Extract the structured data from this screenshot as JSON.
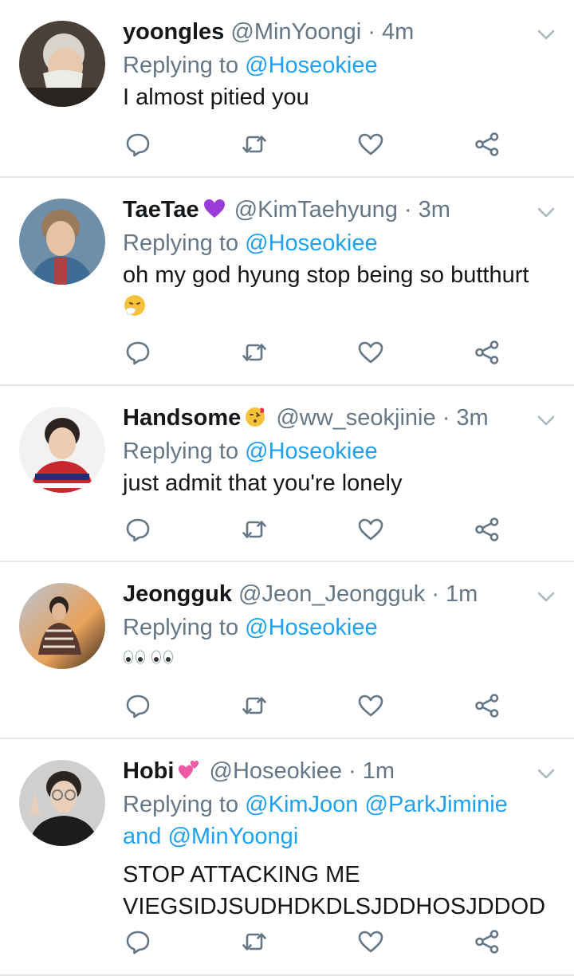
{
  "tweets": [
    {
      "name": "yoongles",
      "handle": "@MinYoongi",
      "time": "· 4m",
      "reply_prefix": "Replying to",
      "mentions": [
        "@Hoseokiee"
      ],
      "text": "I almost pitied you",
      "emoji": ""
    },
    {
      "name": "TaeTae",
      "handle": "@KimTaehyung",
      "time": "· 3m",
      "reply_prefix": "Replying to",
      "mentions": [
        "@Hoseokiee"
      ],
      "text": "oh my god hyung stop being so butthurt",
      "emoji": "purple-heart"
    },
    {
      "name": "Handsome",
      "handle": "@ww_seokjinie",
      "time": "· 3m",
      "reply_prefix": "Replying to",
      "mentions": [
        "@Hoseokiee"
      ],
      "text": "just admit that you're lonely",
      "emoji": "kiss-face"
    },
    {
      "name": "Jeongguk",
      "handle": "@Jeon_Jeongguk",
      "time": "· 1m",
      "reply_prefix": "Replying to",
      "mentions": [
        "@Hoseokiee"
      ],
      "text": "",
      "emoji": ""
    },
    {
      "name": "Hobi",
      "handle": "@Hoseokiee",
      "time": "· 1m",
      "reply_prefix": "Replying to",
      "mentions": [
        "@KimJoon",
        "@ParkJiminie",
        "@MinYoongi"
      ],
      "mention_joiner": "and",
      "text_line1": "STOP ATTACKING ME",
      "text_line2": "VIEGSIDJSUDHDKDLSJDDHOSJDDOD",
      "emoji": "two-hearts"
    }
  ],
  "icons": {
    "reply": "reply-icon",
    "retweet": "retweet-icon",
    "like": "heart-icon",
    "share": "share-icon",
    "more": "chevron-down-icon"
  },
  "colors": {
    "link": "#1da1f2",
    "muted": "#657786",
    "text": "#14171a",
    "divider": "#e1e8ed"
  }
}
